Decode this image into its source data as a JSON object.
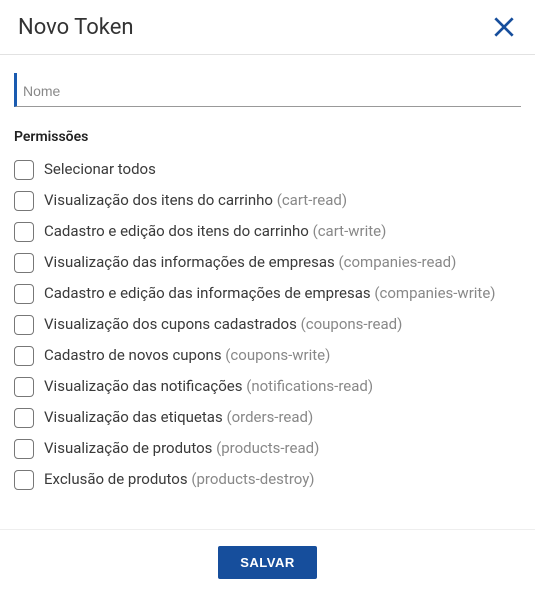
{
  "modal": {
    "title": "Novo Token",
    "name_placeholder": "Nome",
    "section_label": "Permissões",
    "save_label": "SALVAR"
  },
  "permissions": [
    {
      "label": "Selecionar todos",
      "slug": ""
    },
    {
      "label": "Visualização dos itens do carrinho",
      "slug": "(cart-read)"
    },
    {
      "label": "Cadastro e edição dos itens do carrinho",
      "slug": "(cart-write)"
    },
    {
      "label": "Visualização das informações de empresas",
      "slug": "(companies-read)"
    },
    {
      "label": "Cadastro e edição das informações de empresas",
      "slug": "(companies-write)"
    },
    {
      "label": "Visualização dos cupons cadastrados",
      "slug": "(coupons-read)"
    },
    {
      "label": "Cadastro de novos cupons",
      "slug": "(coupons-write)"
    },
    {
      "label": "Visualização das notificações",
      "slug": "(notifications-read)"
    },
    {
      "label": "Visualização das etiquetas",
      "slug": "(orders-read)"
    },
    {
      "label": "Visualização de produtos",
      "slug": "(products-read)"
    },
    {
      "label": "Exclusão de produtos",
      "slug": "(products-destroy)"
    }
  ]
}
